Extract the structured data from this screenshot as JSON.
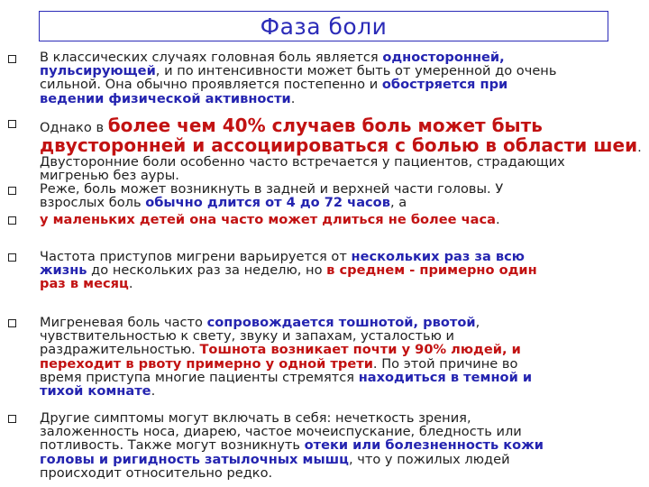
{
  "title": "Фаза боли",
  "p1": {
    "l1a": "В классических случаях головная боль является ",
    "l1b": "односторонней,",
    "l2a": "пульсирующей",
    "l2b": ", и по интенсивности может быть от умеренной до очень",
    "l3a": "сильной. Она обычно проявляется постепенно и ",
    "l3b": "обостряется при",
    "l4a": "ведении физической активности",
    "l4b": "."
  },
  "p2": {
    "l1a": "Однако в ",
    "l1b": "более чем 40% случаев боль может быть",
    "l2a": "двусторонней и ассоциироваться с болью в области шеи",
    "l2b": ".",
    "l3": "Двусторонние боли особенно часто встречается у пациентов, страдающих",
    "l4": "мигренью без ауры."
  },
  "p3": {
    "l1": " Реже, боль может возникнуть в задней и верхней части головы. У",
    "l2a": "взрослых боль ",
    "l2b": "обычно длится от 4 до 72 часов",
    "l2c": ", а"
  },
  "p4": {
    "l1a": "у маленьких детей она часто может длиться не более часа",
    "l1b": "."
  },
  "p5": {
    "l1a": "Частота приступов мигрени варьируется от ",
    "l1b": "нескольких раз за всю",
    "l2a": "жизнь",
    "l2b": " до нескольких раз за неделю, но ",
    "l2c": "в среднем - примерно один",
    "l3a": "раз в месяц",
    "l3b": "."
  },
  "p6": {
    "l1a": "Мигреневая боль часто ",
    "l1b": "сопровождается тошнотой, рвотой",
    "l1c": ",",
    "l2": "чувствительностью к свету, звуку и запахам, усталостью и",
    "l3a": "раздражительностью. ",
    "l3b": "Тошнота возникает почти у 90% людей, и",
    "l4a": "переходит в рвоту примерно у одной трети",
    "l4b": ". По этой причине во",
    "l5a": "время приступа многие пациенты стремятся ",
    "l5b": "находиться в темной и",
    "l6a": "тихой комнате",
    "l6b": "."
  },
  "p7": {
    "l1": "Другие симптомы могут включать в себя: нечеткость зрения,",
    "l2": "заложенность носа, диарею, частое мочеиспускание, бледность или",
    "l3a": "потливость. Также могут возникнуть ",
    "l3b": "отеки или болезненность кожи",
    "l4a": "головы и ригидность затылочных мышц",
    "l4b": ", что у пожилых людей",
    "l5": "происходит относительно редко."
  },
  "colors": {
    "accent": "#2b2bb8",
    "emphasis_blue": "#2424b0",
    "emphasis_red": "#c21212"
  }
}
